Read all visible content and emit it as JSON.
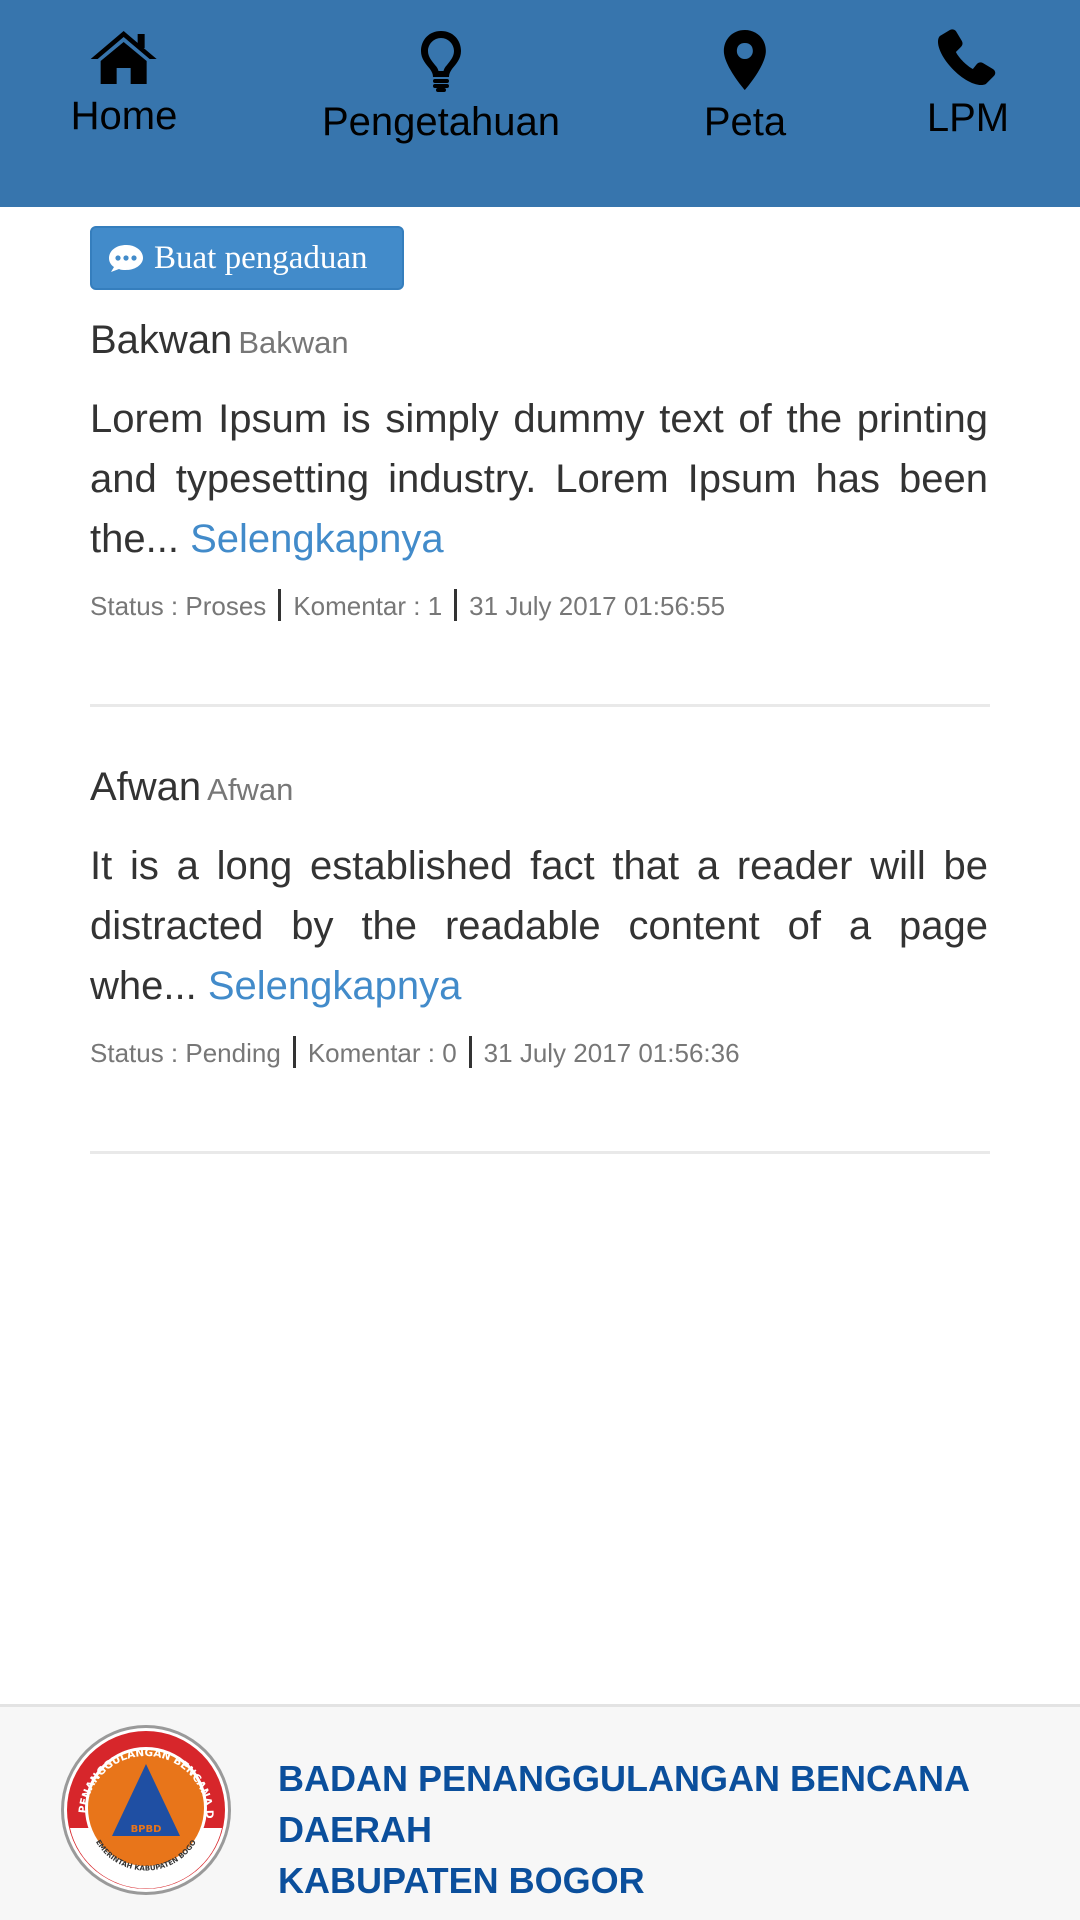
{
  "nav": {
    "items": [
      {
        "label": "Home",
        "icon": "home-icon"
      },
      {
        "label": "Pengetahuan",
        "icon": "lightbulb-icon"
      },
      {
        "label": "Peta",
        "icon": "map-marker-icon"
      },
      {
        "label": "LPM",
        "icon": "phone-icon"
      }
    ],
    "background": "#3775ad"
  },
  "complaint_button": {
    "label": "Buat pengaduan",
    "icon": "comment-icon",
    "color": "#428bca"
  },
  "posts": [
    {
      "title": "Bakwan",
      "subtitle": "Bakwan",
      "excerpt": "Lorem Ipsum is simply dummy text of the printing and typesetting industry. Lorem Ipsum has been the...",
      "read_more": "Selengkapnya",
      "status": "Status : Proses",
      "comments": "Komentar : 1",
      "timestamp": "31 July 2017 01:56:55"
    },
    {
      "title": "Afwan",
      "subtitle": "Afwan",
      "excerpt": "It is a long established fact that a reader will be distracted by the readable content of a page whe...",
      "read_more": "Selengkapnya",
      "status": "Status : Pending",
      "comments": "Komentar : 0",
      "timestamp": "31 July 2017 01:56:36"
    }
  ],
  "footer": {
    "logo": {
      "ring_text": "BADAN PENANGGULANGAN BENCANA DAERAH",
      "center_text": "BPBD",
      "bottom_text": "PEMERINTAH KABUPATEN BOGOR"
    },
    "line1": "BADAN PENANGGULANGAN BENCANA",
    "line2": "DAERAH",
    "line3": "KABUPATEN BOGOR",
    "text_color": "#0b4f9c"
  }
}
